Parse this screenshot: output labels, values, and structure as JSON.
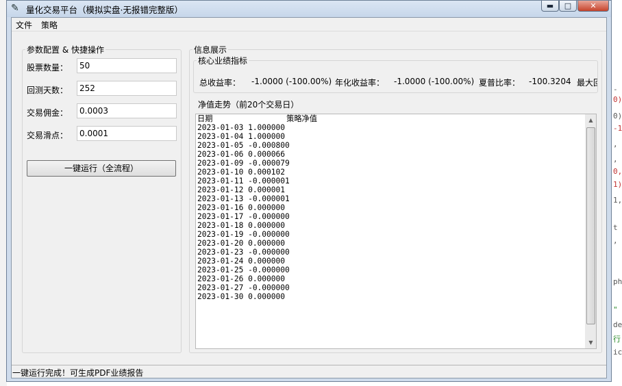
{
  "window": {
    "title": "量化交易平台（模拟实盘·无报错完整版）",
    "controls": {
      "minimize": "▬",
      "maximize": "□",
      "close": "✕"
    }
  },
  "menu": [
    "文件",
    "策略"
  ],
  "params": {
    "group_title": "参数配置 & 快捷操作",
    "fields": [
      {
        "label": "股票数量：",
        "value": "50"
      },
      {
        "label": "回测天数：",
        "value": "252"
      },
      {
        "label": "交易佣金：",
        "value": "0.0003"
      },
      {
        "label": "交易滑点：",
        "value": "0.0001"
      }
    ],
    "run_button": "一键运行（全流程）"
  },
  "info": {
    "group_title": "信息展示",
    "metrics_title": "核心业绩指标",
    "metrics": [
      {
        "label": "总收益率：",
        "value": "-1.0000 (-100.00%)"
      },
      {
        "label": "年化收益率：",
        "value": "-1.0000 (-100.00%)"
      },
      {
        "label": "夏普比率：",
        "value": "-100.3204"
      },
      {
        "label": "最大回",
        "value": ""
      }
    ],
    "nav_title": "净值走势（前20个交易日）",
    "nav_text": "日期                策略净值\n2023-01-03 1.000000\n2023-01-04 1.000000\n2023-01-05 -0.000800\n2023-01-06 0.000066\n2023-01-09 -0.000079\n2023-01-10 0.000102\n2023-01-11 -0.000001\n2023-01-12 0.000001\n2023-01-13 -0.000001\n2023-01-16 0.000000\n2023-01-17 -0.000000\n2023-01-18 0.000000\n2023-01-19 -0.000000\n2023-01-20 0.000000\n2023-01-23 -0.000000\n2023-01-24 0.000000\n2023-01-25 -0.000000\n2023-01-26 0.000000\n2023-01-27 -0.000000\n2023-01-30 0.000000"
  },
  "status": "一键运行完成！可生成PDF业绩报告",
  "background_fragments": [
    "-",
    "0)",
    "0),",
    "-1",
    ",",
    ",",
    "0,",
    "1)",
    "1,",
    "t",
    ",",
    "ph",
    "\"",
    "de",
    "行",
    "ic"
  ]
}
